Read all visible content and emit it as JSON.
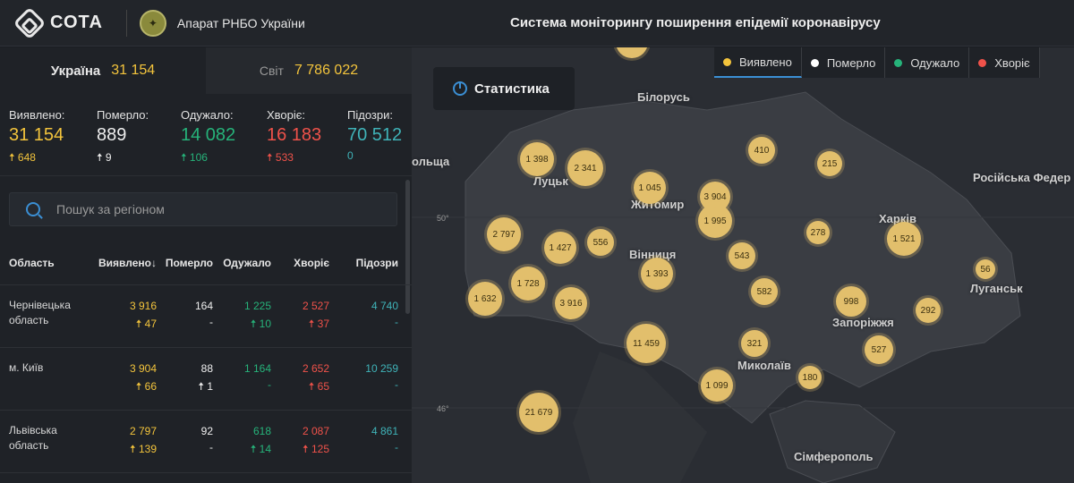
{
  "header": {
    "logo_text": "СОТА",
    "org_name": "Апарат РНБО України",
    "system_title": "Система моніторингу поширення епідемії коронавірусу"
  },
  "tabs": [
    {
      "label": "Україна",
      "value": "31 154"
    },
    {
      "label": "Світ",
      "value": "7 786 022"
    }
  ],
  "stats": [
    {
      "label": "Виявлено:",
      "value": "31 154",
      "delta": "648"
    },
    {
      "label": "Померло:",
      "value": "889",
      "delta": "9"
    },
    {
      "label": "Одужало:",
      "value": "14 082",
      "delta": "106"
    },
    {
      "label": "Хворіє:",
      "value": "16 183",
      "delta": "533"
    },
    {
      "label": "Підозри:",
      "value": "70 512",
      "delta": "0"
    }
  ],
  "search": {
    "placeholder": "Пошук за регіоном"
  },
  "table": {
    "headers": [
      "Область",
      "Виявлено",
      "Померло",
      "Одужало",
      "Хворіє",
      "Підозри"
    ],
    "sort_indicator": "↓",
    "rows": [
      {
        "name": "Чернівецька область",
        "detected": "3 916",
        "detected_delta": "47",
        "died": "164",
        "died_delta": "-",
        "recovered": "1 225",
        "recovered_delta": "10",
        "sick": "2 527",
        "sick_delta": "37",
        "suspected": "4 740",
        "suspected_delta": "-"
      },
      {
        "name": "м. Київ",
        "detected": "3 904",
        "detected_delta": "66",
        "died": "88",
        "died_delta": "1",
        "recovered": "1 164",
        "recovered_delta": "-",
        "sick": "2 652",
        "sick_delta": "65",
        "suspected": "10 259",
        "suspected_delta": "-"
      },
      {
        "name": "Львівська область",
        "detected": "2 797",
        "detected_delta": "139",
        "died": "92",
        "died_delta": "-",
        "recovered": "618",
        "recovered_delta": "14",
        "sick": "2 087",
        "sick_delta": "125",
        "suspected": "4 861",
        "suspected_delta": "-"
      }
    ]
  },
  "map": {
    "statistics_button": "Статистика",
    "legend": [
      {
        "label": "Виявлено",
        "color": "#f3c43c"
      },
      {
        "label": "Померло",
        "color": "#ffffff"
      },
      {
        "label": "Одужало",
        "color": "#26b37a"
      },
      {
        "label": "Хворіє",
        "color": "#f0524a"
      }
    ],
    "place_labels": [
      "Білорусь",
      "Луцьк",
      "Житомир",
      "Вінниця",
      "Харків",
      "Російська Федер",
      "Луганськ",
      "Запоріжжя",
      "Миколаїв",
      "Сімферополь",
      "ольща"
    ],
    "lat_labels": [
      "50°",
      "46°"
    ],
    "clusters": [
      "1 398",
      "2 341",
      "1 045",
      "3 904",
      "1 995",
      "410",
      "215",
      "2 797",
      "1 427",
      "556",
      "278",
      "1 521",
      "1 393",
      "543",
      "56",
      "1 632",
      "1 728",
      "3 916",
      "582",
      "998",
      "292",
      "11 459",
      "321",
      "527",
      "1 099",
      "180",
      "21 679"
    ]
  }
}
